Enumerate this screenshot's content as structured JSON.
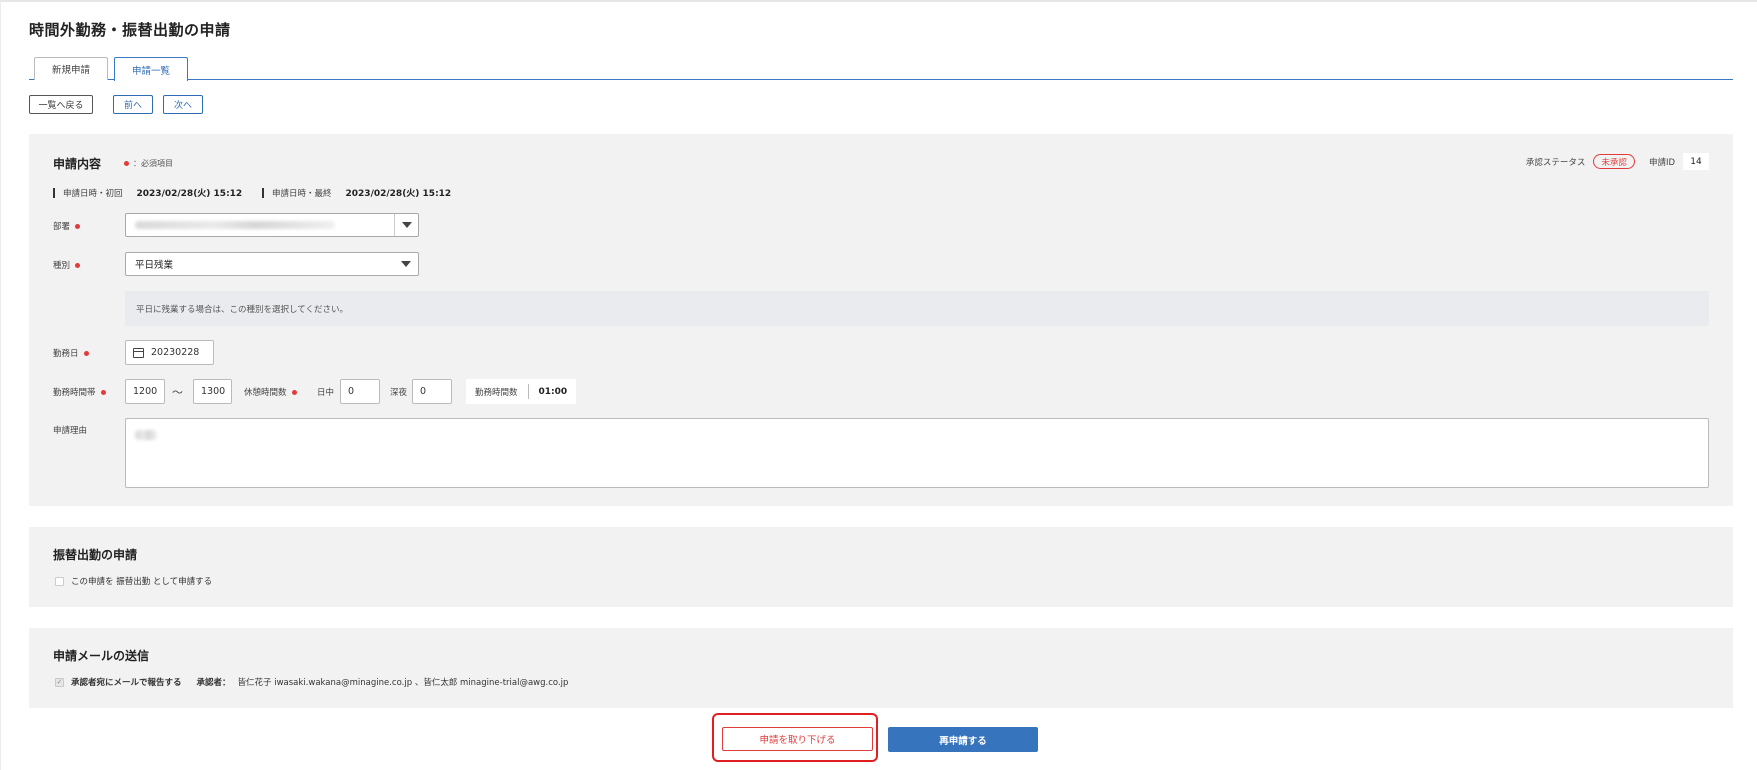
{
  "page": {
    "title": "時間外勤務・振替出勤の申請"
  },
  "tabs": [
    {
      "label": "新規申請",
      "active": false
    },
    {
      "label": "申請一覧",
      "active": true
    }
  ],
  "nav": {
    "back": "一覧へ戻る",
    "prev": "前へ",
    "next": "次へ"
  },
  "application": {
    "title": "申請内容",
    "required_note": "：必須項目",
    "status_label": "承認ステータス",
    "status_value": "未承認",
    "id_label": "申請ID",
    "id_value": "14",
    "first_date_label": "申請日時・初回",
    "first_date_value": "2023/02/28(火) 15:12",
    "last_date_label": "申請日時・最終",
    "last_date_value": "2023/02/28(火) 15:12",
    "department_label": "部署",
    "type_label": "種別",
    "type_value": "平日残業",
    "type_hint": "平日に残業する場合は、この種別を選択してください。",
    "work_date_label": "勤務日",
    "work_date_value": "20230228",
    "work_time_label": "勤務時間帯",
    "time_start": "1200",
    "time_sep": "〜",
    "time_end": "1300",
    "break_label": "休憩時間数",
    "day_label": "日中",
    "day_value": "0",
    "night_label": "深夜",
    "night_value": "0",
    "total_label": "勤務時間数",
    "total_value": "01:00",
    "reason_label": "申請理由"
  },
  "substitute": {
    "title": "振替出勤の申請",
    "checkbox_label": "この申請を 振替出勤 として申請する"
  },
  "mail": {
    "title": "申請メールの送信",
    "checkbox_label": "承認者宛にメールで報告する",
    "approver_label": "承認者：",
    "approvers": "皆仁花子 iwasaki.wakana@minagine.co.jp 、皆仁太郎 minagine-trial@awg.co.jp"
  },
  "actions": {
    "withdraw": "申請を取り下げる",
    "resubmit": "再申請する"
  },
  "colors": {
    "accent": "#3674bd",
    "danger": "#e23b3b",
    "panel": "#f2f2f2"
  }
}
